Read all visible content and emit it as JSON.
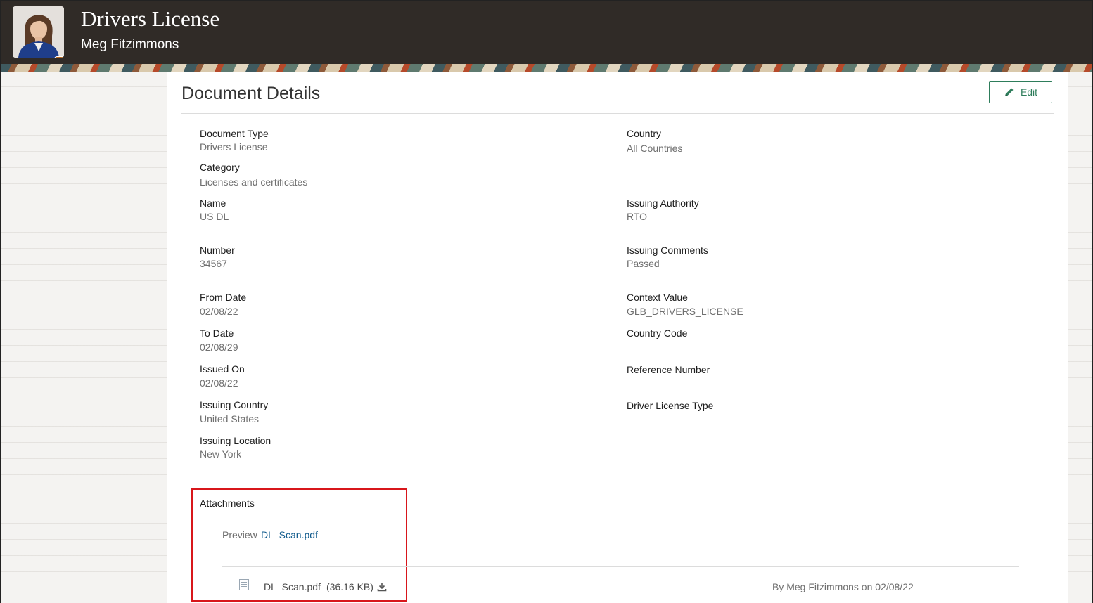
{
  "header": {
    "title": "Drivers License",
    "subtitle": "Meg Fitzimmons",
    "avatar_more": "•••"
  },
  "card": {
    "title": "Document Details",
    "edit_label": "Edit"
  },
  "left_fields": [
    {
      "label": "Document Type",
      "value": "Drivers License"
    },
    {
      "label": "Category",
      "value": "Licenses and certificates"
    },
    {
      "label": "Name",
      "value": "US DL"
    },
    {
      "label": "Number",
      "value": "34567"
    },
    {
      "label": "From Date",
      "value": "02/08/22"
    },
    {
      "label": "To Date",
      "value": "02/08/29"
    },
    {
      "label": "Issued On",
      "value": "02/08/22"
    },
    {
      "label": "Issuing Country",
      "value": "United States"
    },
    {
      "label": "Issuing Location",
      "value": "New York"
    }
  ],
  "right_fields": [
    {
      "label": "Country",
      "value": "All Countries"
    },
    {
      "label": "Issuing Authority",
      "value": "RTO"
    },
    {
      "label": "Issuing Comments",
      "value": "Passed"
    },
    {
      "label": "Context Value",
      "value": "GLB_DRIVERS_LICENSE"
    },
    {
      "label": "Country Code",
      "value": ""
    },
    {
      "label": "Reference Number",
      "value": ""
    },
    {
      "label": "Driver License Type",
      "value": ""
    }
  ],
  "attachments": {
    "title": "Attachments",
    "preview_label": "Preview",
    "preview_link": "DL_Scan.pdf",
    "file_name": "DL_Scan.pdf",
    "file_size": "(36.16 KB)",
    "by_line": "By Meg Fitzimmons on 02/08/22"
  },
  "colors": {
    "header_bg": "#302b27",
    "accent_green": "#2e7d5b",
    "link_blue": "#0f5a8c",
    "highlight_red": "#d8161b"
  }
}
